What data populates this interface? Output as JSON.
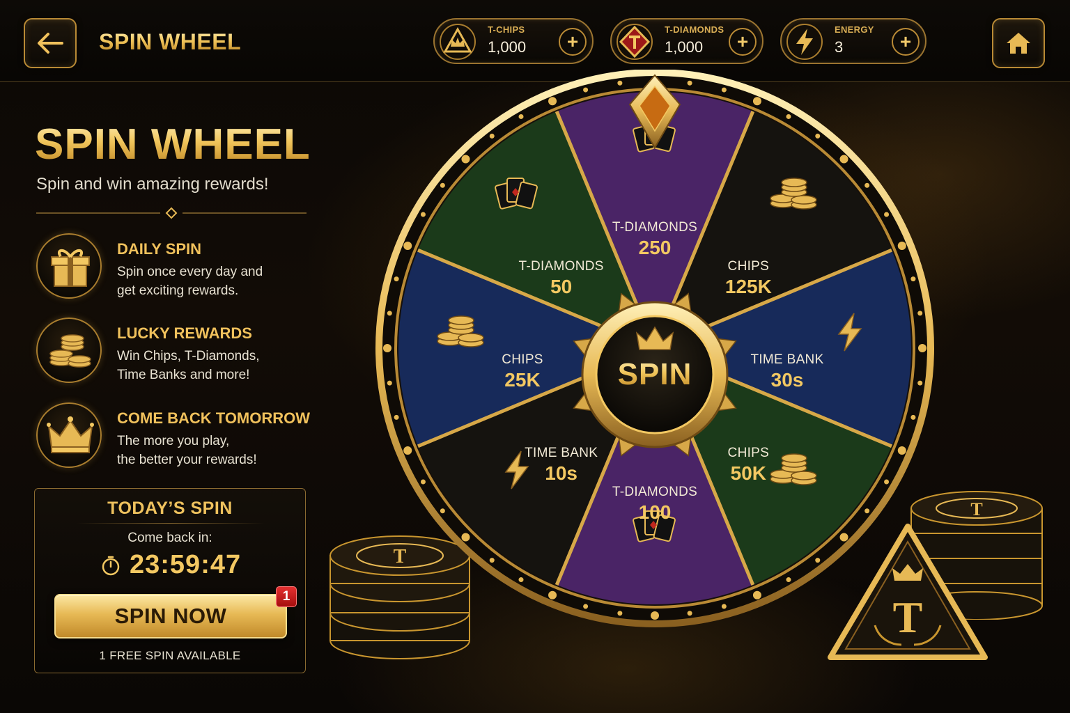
{
  "header": {
    "back_icon": "arrow-left-icon",
    "title": "SPIN WHEEL",
    "home_icon": "home-icon",
    "currencies": [
      {
        "label": "T-CHIPS",
        "value": "1,000",
        "icon": "chip-crown-icon"
      },
      {
        "label": "T-DIAMONDS",
        "value": "1,000",
        "icon": "diamond-icon"
      },
      {
        "label": "ENERGY",
        "value": "3",
        "icon": "lightning-icon"
      }
    ],
    "plus_symbol": "+"
  },
  "panel": {
    "title": "SPIN WHEEL",
    "subtitle": "Spin and win amazing rewards!",
    "features": [
      {
        "title": "DAILY SPIN",
        "desc": "Spin once every day and\nget exciting rewards.",
        "icon": "gift-icon"
      },
      {
        "title": "LUCKY REWARDS",
        "desc": "Win Chips, T-Diamonds,\nTime Banks and more!",
        "icon": "coins-icon"
      },
      {
        "title": "COME BACK TOMORROW",
        "desc": "The more you play,\nthe better your rewards!",
        "icon": "crown-icon"
      }
    ]
  },
  "today": {
    "title": "TODAY’S SPIN",
    "come_back": "Come back in:",
    "timer": "23:59:47",
    "button": "SPIN NOW",
    "badge": "1",
    "free_text": "1 FREE SPIN AVAILABLE"
  },
  "wheel": {
    "center_label": "SPIN",
    "segments": [
      {
        "name": "T-DIAMONDS",
        "value": "250",
        "color": "#4a2466",
        "icon": "cards-icon"
      },
      {
        "name": "CHIPS",
        "value": "125K",
        "color": "#15130f",
        "icon": "chips-stack-icon"
      },
      {
        "name": "TIME BANK",
        "value": "30s",
        "color": "#172a5a",
        "icon": "lightning-icon"
      },
      {
        "name": "CHIPS",
        "value": "50K",
        "color": "#1b3a1a",
        "icon": "chips-stack-icon"
      },
      {
        "name": "T-DIAMONDS",
        "value": "100",
        "color": "#4a2466",
        "icon": "cards-icon"
      },
      {
        "name": "TIME BANK",
        "value": "10s",
        "color": "#15130f",
        "icon": "lightning-icon"
      },
      {
        "name": "CHIPS",
        "value": "25K",
        "color": "#172a5a",
        "icon": "chips-stack-icon"
      },
      {
        "name": "T-DIAMONDS",
        "value": "50",
        "color": "#1b3a1a",
        "icon": "cards-icon"
      }
    ]
  },
  "decor": {
    "chip_letter": "T",
    "colors": {
      "gold": "#e7b955",
      "gold_dark": "#8a6020",
      "badge_red": "#d42020"
    }
  }
}
